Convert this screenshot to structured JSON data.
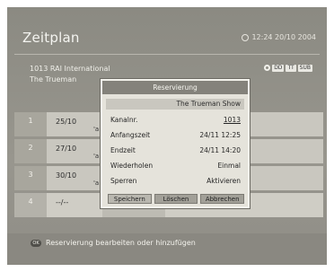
{
  "header": {
    "title": "Zeitplan",
    "clock": "12:24 20/10 2004"
  },
  "channel": {
    "line1": "1013 RAI International",
    "line2": "The Trueman"
  },
  "info_icons": [
    "DD",
    "TT",
    "SUB"
  ],
  "rows": [
    {
      "num": "1",
      "date": "25/10",
      "frag": "'a"
    },
    {
      "num": "2",
      "date": "27/10",
      "frag": "'a"
    },
    {
      "num": "3",
      "date": "30/10",
      "frag": "'a"
    },
    {
      "num": "4",
      "date": "--/--",
      "frag": ""
    }
  ],
  "dialog": {
    "title": "Reservierung",
    "program": "The Trueman Show",
    "fields": [
      {
        "label": "Kanalnr.",
        "value": "1013"
      },
      {
        "label": "Anfangszeit",
        "value": "24/11 12:25"
      },
      {
        "label": "Endzeit",
        "value": "24/11 14:20"
      },
      {
        "label": "Wiederholen",
        "value": "Einmal"
      },
      {
        "label": "Sperren",
        "value": "Aktivieren"
      }
    ],
    "buttons": {
      "save": "Speichern",
      "delete": "Löschen",
      "cancel": "Abbrechen"
    }
  },
  "footer": {
    "ok": "OK",
    "hint": "Reservierung bearbeiten oder hinzufügen"
  }
}
